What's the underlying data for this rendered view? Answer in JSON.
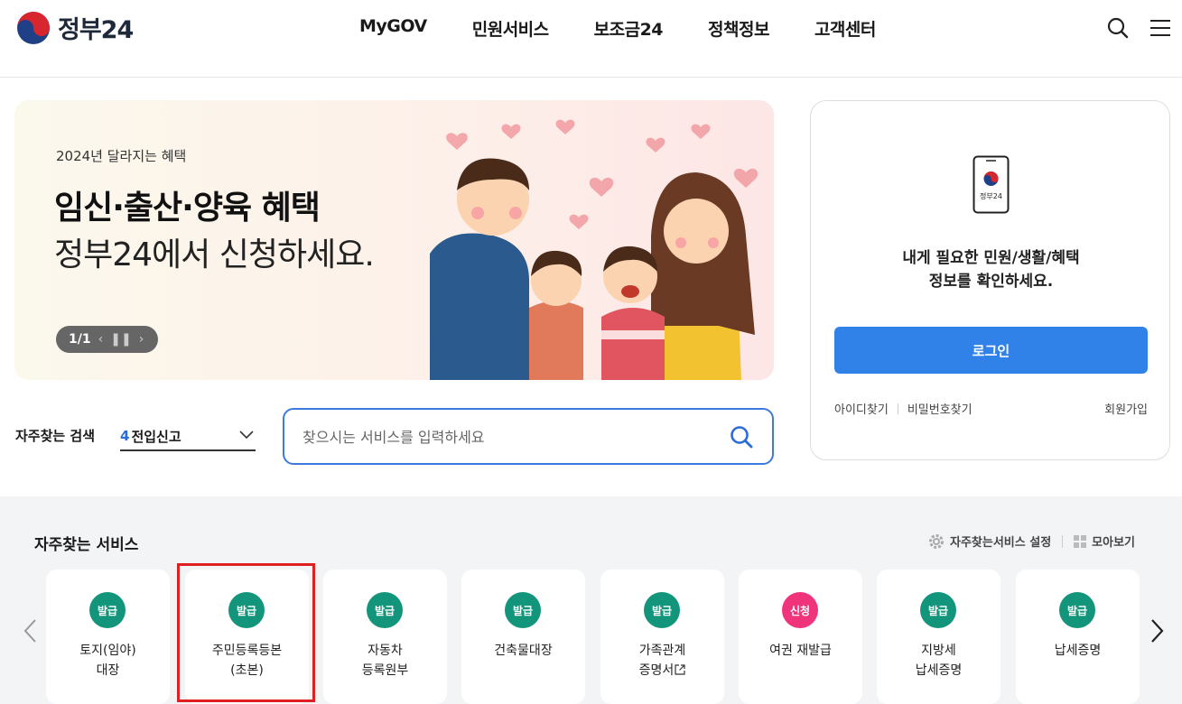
{
  "header": {
    "logo_text": "정부24",
    "nav": [
      "MyGOV",
      "민원서비스",
      "보조금24",
      "정책정보",
      "고객센터"
    ]
  },
  "banner": {
    "subtitle": "2024년 달라지는 혜택",
    "title": "임신·출산·양육 혜택",
    "line2": "정부24에서 신청하세요.",
    "pager": "1/1"
  },
  "frequent_search": {
    "label": "자주찾는 검색",
    "rank": "4",
    "keyword": "전입신고"
  },
  "search": {
    "placeholder": "찾으시는 서비스를 입력하세요"
  },
  "login": {
    "device_label": "정부24",
    "message_line1": "내게 필요한 민원/생활/혜택",
    "message_line2": "정보를 확인하세요.",
    "button": "로그인",
    "find_id": "아이디찾기",
    "find_pw": "비밀번호찾기",
    "signup": "회원가입"
  },
  "services": {
    "title": "자주찾는 서비스",
    "settings_label": "자주찾는서비스 설정",
    "collect_label": "모아보기",
    "colors": {
      "issue": "#12957a",
      "apply": "#f0347c"
    },
    "items": [
      {
        "badge": "발급",
        "type": "issue",
        "line1": "토지(임야)",
        "line2": "대장"
      },
      {
        "badge": "발급",
        "type": "issue",
        "line1": "주민등록등본",
        "line2": "(초본)"
      },
      {
        "badge": "발급",
        "type": "issue",
        "line1": "자동차",
        "line2": "등록원부"
      },
      {
        "badge": "발급",
        "type": "issue",
        "line1": "건축물대장",
        "line2": ""
      },
      {
        "badge": "발급",
        "type": "issue",
        "line1": "가족관계",
        "line2": "증명서"
      },
      {
        "badge": "신청",
        "type": "apply",
        "line1": "여권 재발급",
        "line2": ""
      },
      {
        "badge": "발급",
        "type": "issue",
        "line1": "지방세",
        "line2": "납세증명"
      },
      {
        "badge": "발급",
        "type": "issue",
        "line1": "납세증명",
        "line2": ""
      }
    ]
  }
}
